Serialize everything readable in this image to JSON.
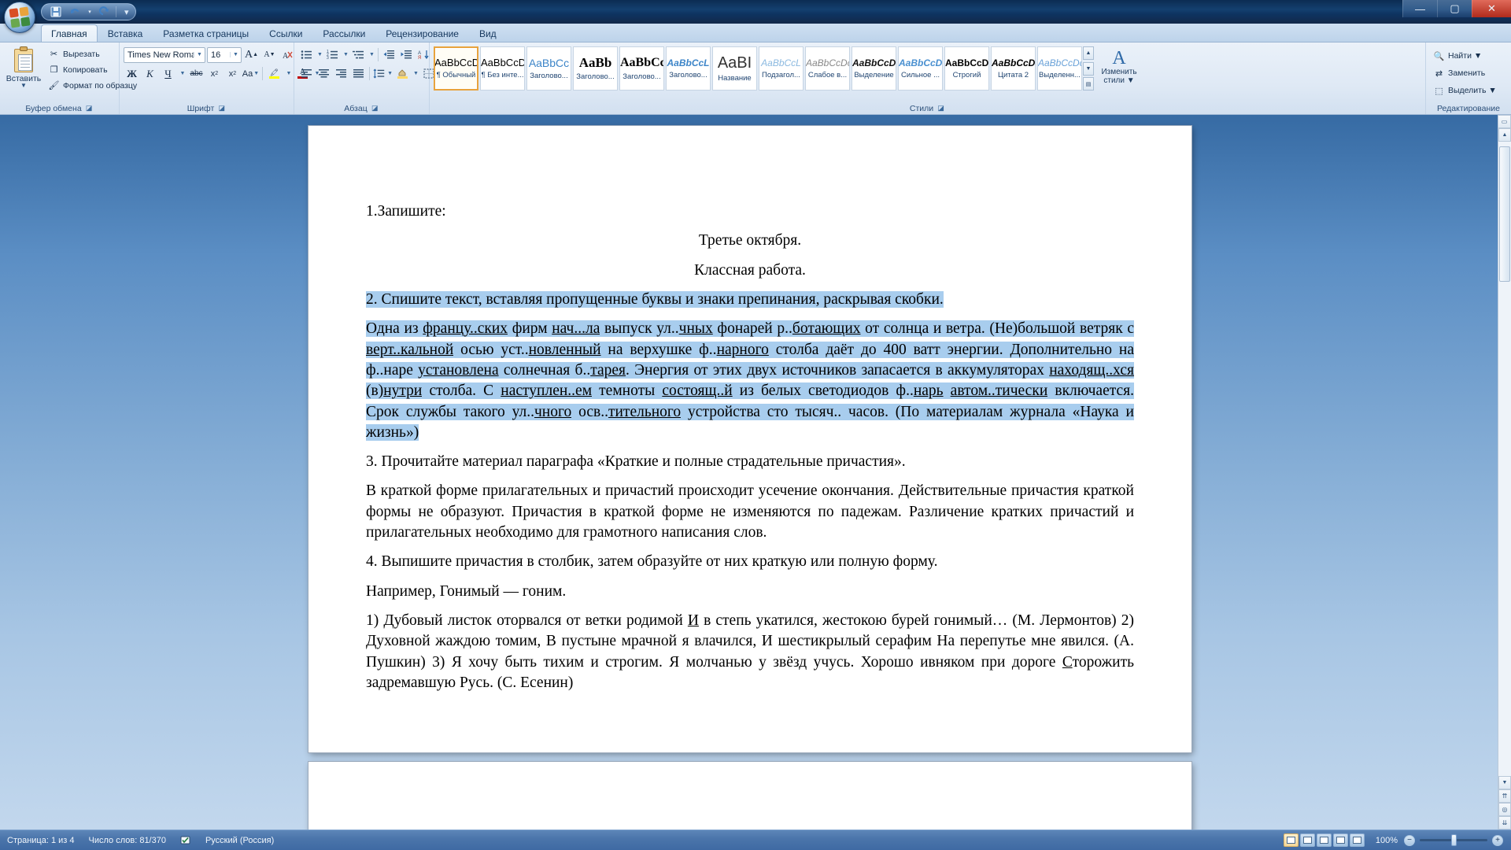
{
  "window": {
    "title": "",
    "minimize_label": "—",
    "maximize_label": "▢",
    "close_label": "✕"
  },
  "quick_access": {
    "save_tooltip": "Сохранить",
    "undo_tooltip": "Отменить",
    "redo_tooltip": "Вернуть",
    "customize_tooltip": "Настройка панели быстрого доступа"
  },
  "tabs": [
    {
      "label": "Главная",
      "active": true
    },
    {
      "label": "Вставка",
      "active": false
    },
    {
      "label": "Разметка страницы",
      "active": false
    },
    {
      "label": "Ссылки",
      "active": false
    },
    {
      "label": "Рассылки",
      "active": false
    },
    {
      "label": "Рецензирование",
      "active": false
    },
    {
      "label": "Вид",
      "active": false
    }
  ],
  "ribbon": {
    "clipboard": {
      "group_label": "Буфер обмена",
      "paste_label": "Вставить",
      "paste_arrow": "▼",
      "commands": [
        {
          "label": "Вырезать",
          "icon": "scissors-icon",
          "glyph": "✂"
        },
        {
          "label": "Копировать",
          "icon": "copy-icon",
          "glyph": "❐"
        },
        {
          "label": "Формат по образцу",
          "icon": "format-painter-icon",
          "glyph": "🖌"
        }
      ]
    },
    "font": {
      "group_label": "Шрифт",
      "font_name": "Times New Roman",
      "font_size": "16",
      "grow_font": "A",
      "shrink_font": "A",
      "clear_format": "⌫",
      "bold": "Ж",
      "italic": "К",
      "underline": "Ч",
      "strikethrough": "abc",
      "subscript": "x",
      "subscript_sub": "2",
      "superscript": "x",
      "superscript_sup": "2",
      "change_case": "Aa",
      "highlight": "ab",
      "font_color": "A",
      "highlight_color": "#ffff00",
      "font_color_value": "#c00000"
    },
    "paragraph": {
      "group_label": "Абзац",
      "bullets": "•",
      "numbering": "1.",
      "multilevel": "⊞",
      "decrease_indent": "⇤",
      "increase_indent": "⇥",
      "sort": "A↓",
      "show_marks": "¶",
      "align_left": "≡",
      "align_center": "≡",
      "align_right": "≡",
      "justify": "≡",
      "line_spacing": "↕≡",
      "shading": "▣",
      "borders": "⊞"
    },
    "styles": {
      "group_label": "Стили",
      "items": [
        {
          "preview": "AaBbCcDc",
          "name": "¶ Обычный",
          "selected": true,
          "preview_style": "normal"
        },
        {
          "preview": "AaBbCcD",
          "name": "¶ Без инте...",
          "selected": false,
          "preview_style": "normal"
        },
        {
          "preview": "AaBbCс",
          "name": "Заголово...",
          "selected": false,
          "preview_style": "h1"
        },
        {
          "preview": "AaBb",
          "name": "Заголово...",
          "selected": false,
          "preview_style": "h2"
        },
        {
          "preview": "AaBbCс",
          "name": "Заголово...",
          "selected": false,
          "preview_style": "h3"
        },
        {
          "preview": "AaBbCcL",
          "name": "Заголово...",
          "selected": false,
          "preview_style": "h4"
        },
        {
          "preview": "AaBI",
          "name": "Название",
          "selected": false,
          "preview_style": "title"
        },
        {
          "preview": "AaBbCcL",
          "name": "Подзагол...",
          "selected": false,
          "preview_style": "subtitle"
        },
        {
          "preview": "AaBbCcDc",
          "name": "Слабое в...",
          "selected": false,
          "preview_style": "subtle"
        },
        {
          "preview": "AaBbCcDc",
          "name": "Выделение",
          "selected": false,
          "preview_style": "emph"
        },
        {
          "preview": "AaBbCcDc",
          "name": "Сильное ...",
          "selected": false,
          "preview_style": "strong-emph"
        },
        {
          "preview": "AaBbCcDc",
          "name": "Строгий",
          "selected": false,
          "preview_style": "strict"
        },
        {
          "preview": "AaBbCcDc",
          "name": "Цитата 2",
          "selected": false,
          "preview_style": "quote"
        },
        {
          "preview": "AaBbCcDc",
          "name": "Выделенн...",
          "selected": false,
          "preview_style": "selected"
        }
      ],
      "nav_up": "▲",
      "nav_down": "▼",
      "nav_more": "▤",
      "change_styles_icon": "A",
      "change_styles_line1": "Изменить",
      "change_styles_line2": "стили ▼"
    },
    "editing": {
      "group_label": "Редактирование",
      "commands": [
        {
          "label": "Найти ▼",
          "icon": "search-icon",
          "glyph": "🔍"
        },
        {
          "label": "Заменить",
          "icon": "replace-icon",
          "glyph": "⇄"
        },
        {
          "label": "Выделить ▼",
          "icon": "select-icon",
          "glyph": "⬚"
        }
      ]
    }
  },
  "document": {
    "paragraphs": [
      {
        "id": "p1",
        "align": "left",
        "selected": false,
        "runs": [
          {
            "t": "1.Запишите:"
          }
        ]
      },
      {
        "id": "p2",
        "align": "center",
        "selected": false,
        "runs": [
          {
            "t": "Третье октября."
          }
        ]
      },
      {
        "id": "p3",
        "align": "center",
        "selected": false,
        "runs": [
          {
            "t": "Классная работа."
          }
        ]
      },
      {
        "id": "p4",
        "align": "left",
        "selected": true,
        "runs": [
          {
            "t": "2. Спишите текст, вставляя пропущенные буквы и знаки препинания, раскрывая скобки."
          }
        ]
      },
      {
        "id": "p5",
        "align": "justify",
        "selected": true,
        "runs": [
          {
            "t": " Одна из "
          },
          {
            "t": "францу..ских",
            "u": true
          },
          {
            "t": " фирм "
          },
          {
            "t": "нач...ла",
            "u": true
          },
          {
            "t": " выпуск ул.."
          },
          {
            "t": "чных",
            "u": true
          },
          {
            "t": " фонарей р.."
          },
          {
            "t": "ботающих",
            "u": true
          },
          {
            "t": " от солнца и ветра. (Не)большой ветряк с "
          },
          {
            "t": "верт..кальной",
            "u": true
          },
          {
            "t": " осью уст.."
          },
          {
            "t": "новленный",
            "u": true
          },
          {
            "t": " на верхушке ф.."
          },
          {
            "t": "нарного",
            "u": true
          },
          {
            "t": " столба даёт до 400 ватт энергии. Дополнительно на ф..наре "
          },
          {
            "t": "установлена",
            "u": true
          },
          {
            "t": " солнечная б.."
          },
          {
            "t": "тарея",
            "u": true
          },
          {
            "t": ". Энергия от этих двух источников запасается в аккумуляторах "
          },
          {
            "t": "находящ..хся",
            "u": true
          },
          {
            "t": " (в)"
          },
          {
            "t": "нутри",
            "u": true
          },
          {
            "t": " столба. С "
          },
          {
            "t": "наступлен..ем",
            "u": true
          },
          {
            "t": " темноты "
          },
          {
            "t": "состоящ..й",
            "u": true
          },
          {
            "t": " из белых светодиодов ф.."
          },
          {
            "t": "нарь",
            "u": true
          },
          {
            "t": " "
          },
          {
            "t": "автом..тически",
            "u": true
          },
          {
            "t": " включается. Срок службы такого ул.."
          },
          {
            "t": "чного",
            "u": true
          },
          {
            "t": " осв.."
          },
          {
            "t": "тительного",
            "u": true
          },
          {
            "t": " устройства сто тысяч.. часов. (По материалам журнала «Наука и жизнь»)"
          }
        ]
      },
      {
        "id": "p6",
        "align": "left",
        "selected": false,
        "runs": [
          {
            "t": "3. Прочитайте материал параграфа «Краткие и полные страдательные причастия»."
          }
        ]
      },
      {
        "id": "p7",
        "align": "justify",
        "selected": false,
        "runs": [
          {
            "t": "В краткой форме прилагательных и причастий происходит усечение окончания. Действительные причастия краткой формы не образуют. Причастия в краткой форме не изменяются по падежам. Различение кратких причастий и прилагательных необходимо для грамотного написания слов."
          }
        ]
      },
      {
        "id": "p8",
        "align": "left",
        "selected": false,
        "runs": [
          {
            "t": "4. Выпишите причастия в столбик, затем образуйте от них краткую или полную форму."
          }
        ]
      },
      {
        "id": "p9",
        "align": "left",
        "selected": false,
        "runs": [
          {
            "t": "Например, Гонимый — гоним."
          }
        ]
      },
      {
        "id": "p10",
        "align": "justify",
        "selected": false,
        "runs": [
          {
            "t": " 1) Дубовый листок оторвался от ветки родимой "
          },
          {
            "t": "И",
            "u": true
          },
          {
            "t": " в степь укатился, жестокою бурей гонимый… (М. Лермонтов) 2) Духовной жаждою томим, В пустыне мрачной я влачился, И шестикрылый серафим На перепутье мне явился. (А. Пушкин) 3) Я хочу быть тихим и строгим. Я молчанью у звёзд учусь. Хорошо ивняком при дороге "
          },
          {
            "t": "С",
            "u": true
          },
          {
            "t": "торожить задремавшую Русь. (С. Есенин)"
          }
        ]
      }
    ]
  },
  "statusbar": {
    "page_info": "Страница: 1 из 4",
    "word_count": "Число слов: 81/370",
    "proofing_icon": "spellcheck-icon",
    "language": "Русский (Россия)",
    "view_buttons": [
      {
        "name": "print-layout",
        "active": true
      },
      {
        "name": "full-screen-reading",
        "active": false
      },
      {
        "name": "web-layout",
        "active": false
      },
      {
        "name": "outline",
        "active": false
      },
      {
        "name": "draft",
        "active": false
      }
    ],
    "zoom_percent": "100%",
    "zoom_out": "−",
    "zoom_in": "+"
  },
  "scrollbar": {
    "up_arrow": "▲",
    "down_arrow": "▼",
    "prev_page": "⇈",
    "select_object": "◎",
    "next_page": "⇊"
  },
  "colors": {
    "selection_highlight": "#a8cdee",
    "ribbon_accent": "#e8a33d",
    "status_bg": "#4a74aa",
    "titlebar_bg": "#12406f"
  }
}
